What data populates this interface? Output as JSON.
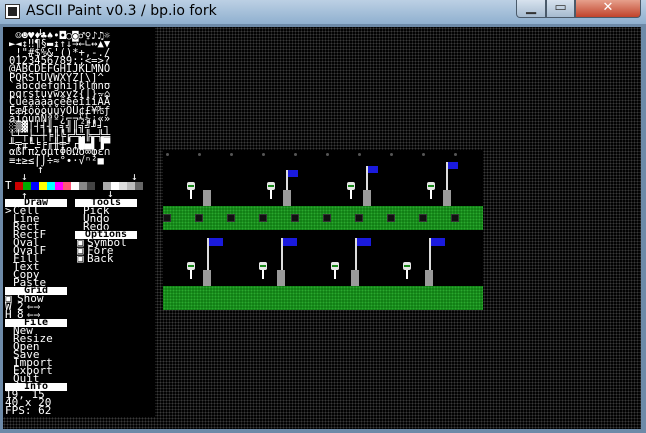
{
  "window": {
    "title": "ASCII Paint v0.3 / bp.io fork"
  },
  "titlebar_buttons": {
    "minimize": "▁",
    "maximize": "▭",
    "close": "✕"
  },
  "glyph_rows": [
    " ☺☻♥♦♣♠•◘○◙♂♀♪♫☼",
    "►◄↕‼¶§▬↨↑↓→←∟↔▲▼",
    " !\"#$%&'()*+,-./",
    "0123456789:;<=>?",
    "@ABCDEFGHIJKLMNO",
    "PQRSTUVWXYZ[\\]^_",
    "`abcdefghijklmno",
    "pqrstuvwxyz{|}~⌂",
    "ÇüéâäàåçêëèïîìÄÅ",
    "ÉæÆôöòûùÿÖÜ¢£¥₧ƒ",
    "áíóúñÑªº¿⌐¬½¼¡«»",
    "░▒▓│┤╡╢╖╕╣║╗╝╜╛┐",
    "└┴┬├─┼╞╟╚╔╩╦╠═╬╧",
    "╨╤╥╙╘╒╓╫╪┘┌█▄▌▐▀",
    "αßΓπΣσµτΦΘΩδ∞φε∩",
    "≡±≥≤⌠⌡÷≈°∙·√ⁿ²■ "
  ],
  "palette": {
    "label": "T",
    "colors": [
      "#cc0000",
      "#00aa00",
      "#0000ff",
      "#ffff00",
      "#00ffff",
      "#ff00ff",
      "#ff5577",
      "#ffffff",
      "#888888",
      "#444444",
      "#000000",
      "#aaaaaa",
      "#ffffff",
      "#dddddd",
      "#bbbbbb",
      "#666666"
    ]
  },
  "draw": {
    "header": "Draw",
    "items": [
      "Cell",
      "Line",
      "Rect",
      "RectF",
      "Oval",
      "OvalF",
      "Fill",
      "Text",
      "Copy",
      "Paste"
    ],
    "selected_marker": ">"
  },
  "tools": {
    "header": "Tools",
    "items": [
      "Pick",
      "Undo",
      "Redo"
    ]
  },
  "options": {
    "header": "Options",
    "items": [
      "Symbol",
      "Fore",
      "Back"
    ]
  },
  "grid": {
    "header": "Grid",
    "show_label": "Show",
    "w_label": "W",
    "w_value": "2",
    "h_label": "H",
    "h_value": "8"
  },
  "file": {
    "header": "File",
    "items": [
      "New",
      "Resize",
      "Open",
      "Save",
      "Import",
      "Export",
      "Quit"
    ]
  },
  "info": {
    "header": "Info",
    "cursor": "19, 15",
    "size": "40 x 20",
    "fps": "FPS: 62"
  }
}
